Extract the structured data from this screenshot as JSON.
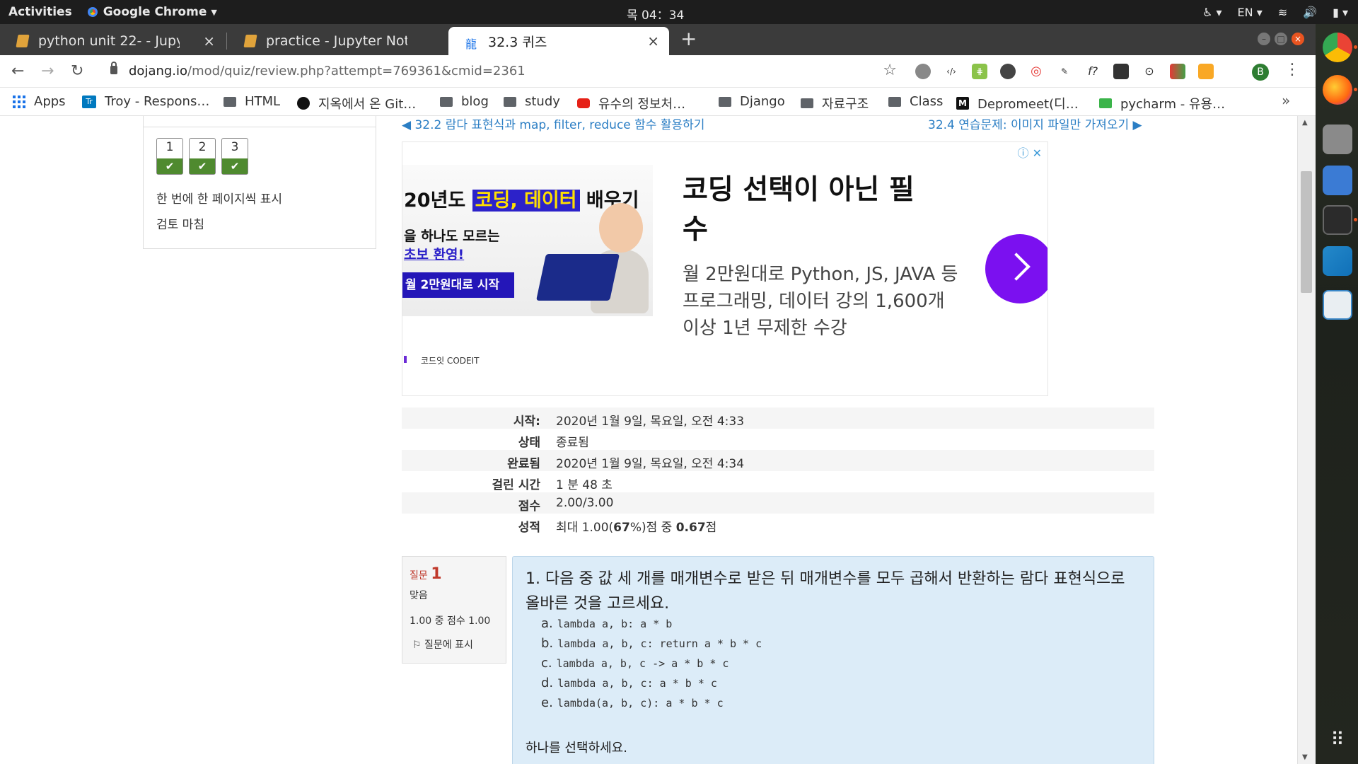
{
  "topbar": {
    "activities": "Activities",
    "app": "Google Chrome",
    "clock": "목 04：34",
    "lang": "EN"
  },
  "tabs": [
    {
      "title": "python unit 22- - Jupyter N"
    },
    {
      "title": "practice - Jupyter Notebo"
    },
    {
      "title": "32.3 퀴즈"
    }
  ],
  "tab_close": "×",
  "new_tab": "+",
  "address": {
    "host": "dojang.io",
    "path": "/mod/quiz/review.php?attempt=769361&cmid=2361"
  },
  "profile_initial": "B",
  "bookmarks": [
    {
      "label": "Apps"
    },
    {
      "label": "Troy - Respons…"
    },
    {
      "label": "HTML"
    },
    {
      "label": "지옥에서 온 Git…"
    },
    {
      "label": "blog"
    },
    {
      "label": "study"
    },
    {
      "label": "유수의 정보처…"
    },
    {
      "label": "Django"
    },
    {
      "label": "자료구조"
    },
    {
      "label": "Class"
    },
    {
      "label": "Depromeet(디…"
    },
    {
      "label": "pycharm - 유용…"
    }
  ],
  "bookmarks_more": "»",
  "quiz_nav": {
    "boxes": [
      "1",
      "2",
      "3"
    ],
    "show_one_page": "한 번에 한 페이지씩 표시",
    "finish_review": "검토 마침"
  },
  "prev_link": "◀ 32.2 람다 표현식과 map, filter, reduce 함수 활용하기",
  "next_link": "32.4 연습문제: 이미지 파일만 가져오기 ▶",
  "ad": {
    "line1_pre": "20년도 ",
    "line1_hl": "코딩, 데이터",
    "line1_post": " 배우기",
    "line2": "을 하나도 모르는",
    "line3": "초보 환영!",
    "cta": "월 2만원대로 시작",
    "brand": "코드잇 CODEIT",
    "headline": "코딩 선택이 아닌 필수",
    "desc": "월 2만원대로 Python, JS, JAVA 등 프로그래밍, 데이터 강의 1,600개 이상 1년 무제한 수강"
  },
  "summary": [
    {
      "k": "시작:",
      "v": "2020년 1월 9일, 목요일, 오전 4:33"
    },
    {
      "k": "상태",
      "v": "종료됨"
    },
    {
      "k": "완료됨",
      "v": "2020년 1월 9일, 목요일, 오전 4:34"
    },
    {
      "k": "걸린 시간",
      "v": "1 분 48 초"
    },
    {
      "k": "점수",
      "v": "2.00/3.00"
    },
    {
      "k": "성적",
      "v_pre": "최대 1.00(",
      "v_b1": "67",
      "v_mid": "%)점 중 ",
      "v_b2": "0.67",
      "v_post": "점"
    }
  ],
  "question": {
    "label": "질문",
    "number": "1",
    "state": "맞음",
    "mark": "1.00 중 점수 1.00",
    "flag": "질문에 표시",
    "text": "1. 다음 중 값 세 개를 매개변수로 받은 뒤 매개변수를 모두 곱해서 반환하는 람다 표현식으로 올바른 것을 고르세요.",
    "options": [
      {
        "letter": "a.",
        "code": "lambda a, b: a * b"
      },
      {
        "letter": "b.",
        "code": "lambda a, b, c: return a * b * c"
      },
      {
        "letter": "c.",
        "code": "lambda a, b, c -> a * b * c"
      },
      {
        "letter": "d.",
        "code": "lambda a, b, c: a * b * c"
      },
      {
        "letter": "e.",
        "code": "lambda(a, b, c): a * b * c"
      }
    ],
    "prompt": "하나를 선택하세요."
  }
}
